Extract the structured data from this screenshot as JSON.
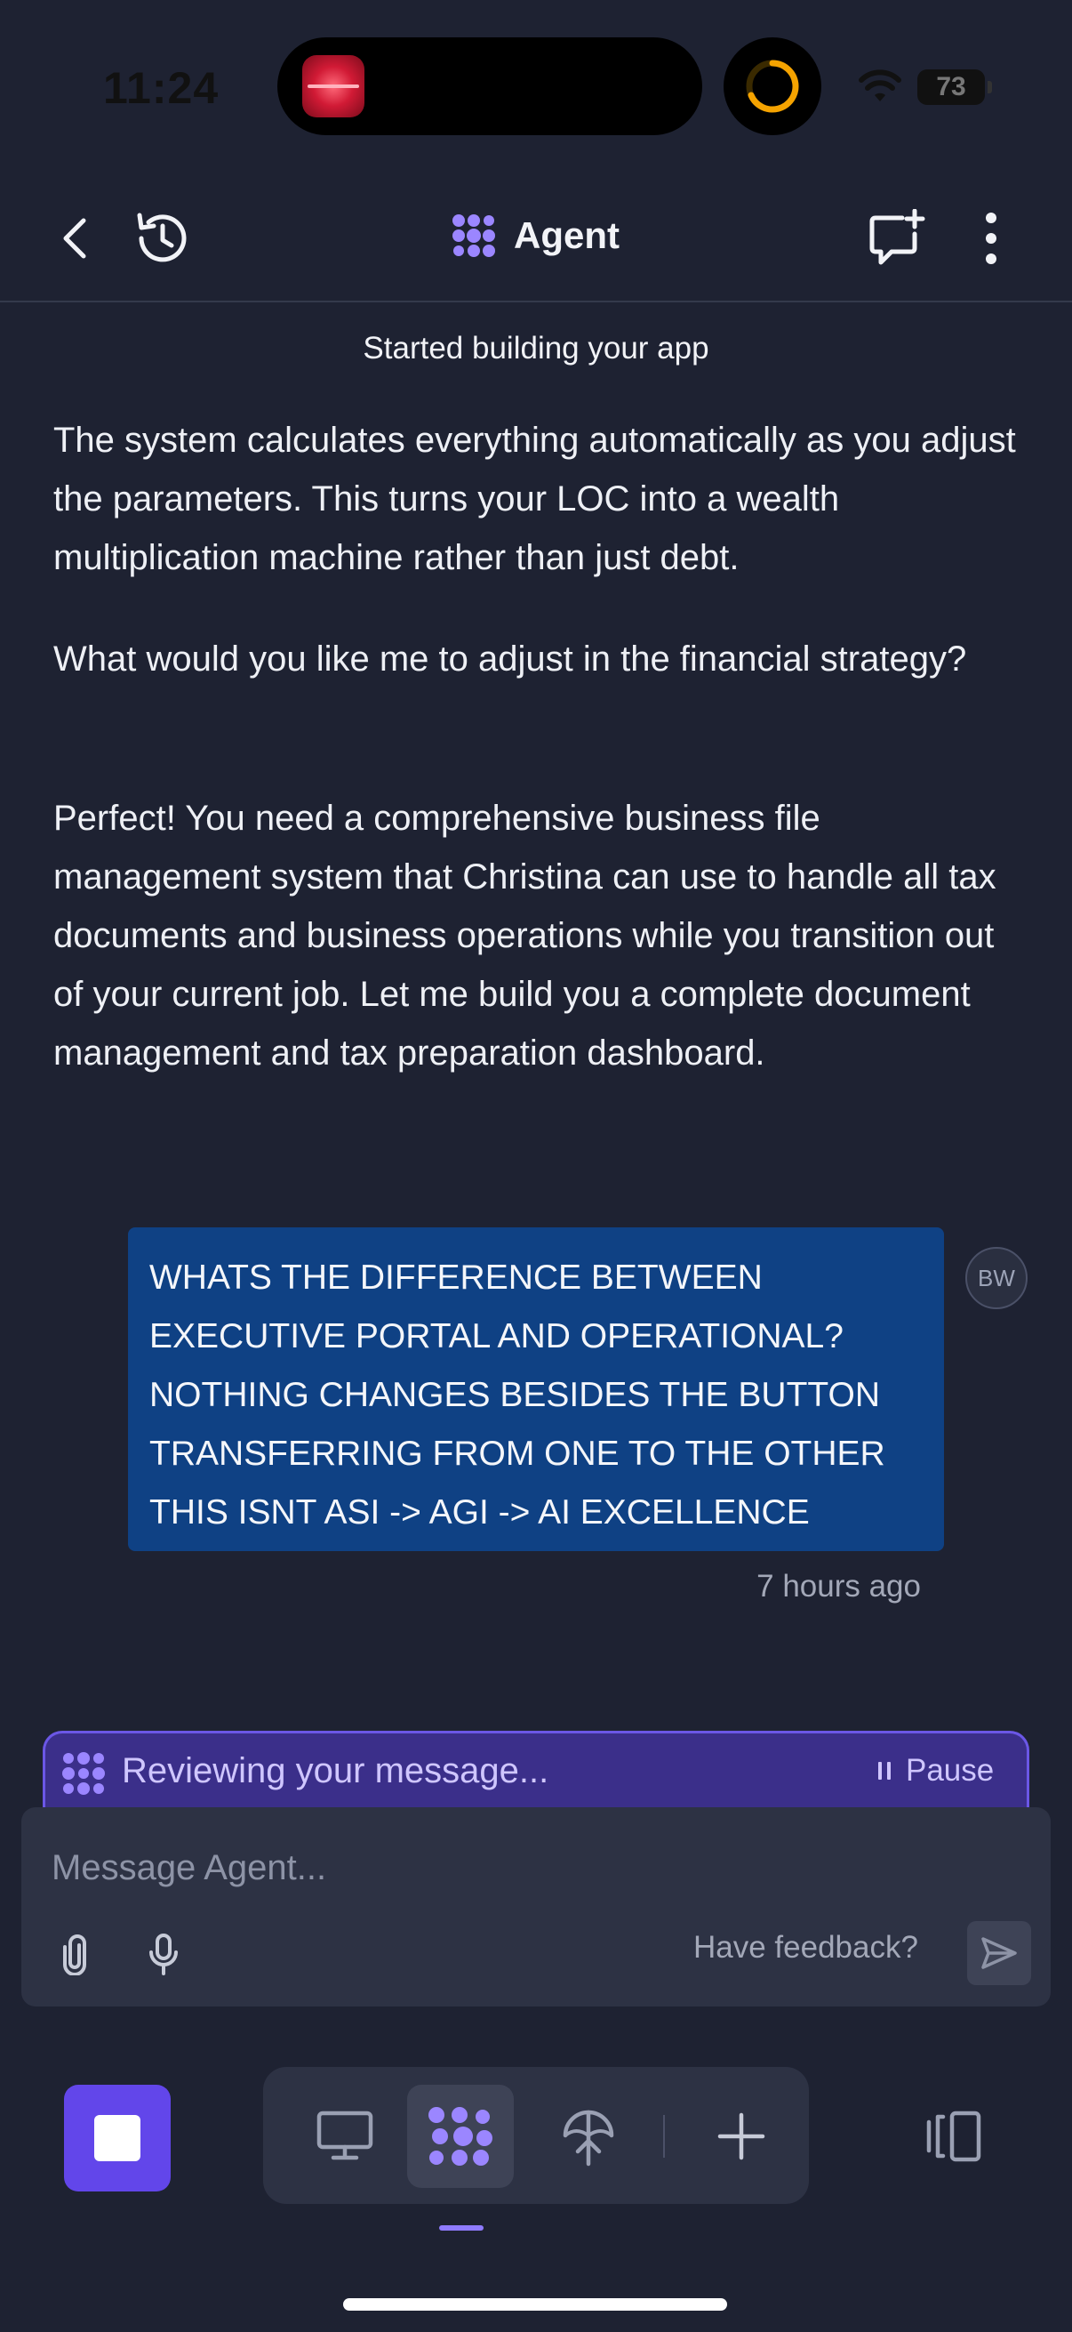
{
  "status_bar": {
    "time": "11:24",
    "battery": "73"
  },
  "header": {
    "title": "Agent"
  },
  "chat": {
    "status_line": "Started building your app",
    "agent_messages": [
      "The system calculates everything automatically as you adjust the parameters. This turns your LOC into a wealth multiplication machine rather than just debt.",
      "What would you like me to adjust in the financial strategy?",
      "Perfect! You need a comprehensive business file management system that Christina can use to handle all tax documents and business operations while you transition out of your current job. Let me build you a complete document management and tax preparation dashboard."
    ],
    "user_message": "WHATS THE DIFFERENCE BETWEEN EXECUTIVE PORTAL AND OPERATIONAL? NOTHING CHANGES BESIDES THE BUTTON TRANSFERRING FROM ONE TO THE OTHER THIS ISNT ASI -> AGI -> AI EXCELLENCE",
    "user_avatar": "BW",
    "user_timestamp": "7 hours ago"
  },
  "agent_status": {
    "text": "Reviewing your message...",
    "pause_label": "Pause"
  },
  "composer": {
    "placeholder": "Message Agent...",
    "value": "",
    "feedback_label": "Have feedback?"
  },
  "icons": {
    "back": "chevron-left-icon",
    "history": "history-icon",
    "new_chat": "new-chat-icon",
    "more": "more-vertical-icon",
    "agent": "agent-logo-icon",
    "attach": "paperclip-icon",
    "mic": "microphone-icon",
    "send": "send-icon",
    "preview": "monitor-icon",
    "deploy": "deploy-icon",
    "add": "plus-icon",
    "panels": "panels-icon"
  },
  "colors": {
    "background": "#1e2232",
    "accent": "#6246ea",
    "user_bubble": "#0f4184",
    "agent_status_bg": "#3b2f8a"
  }
}
